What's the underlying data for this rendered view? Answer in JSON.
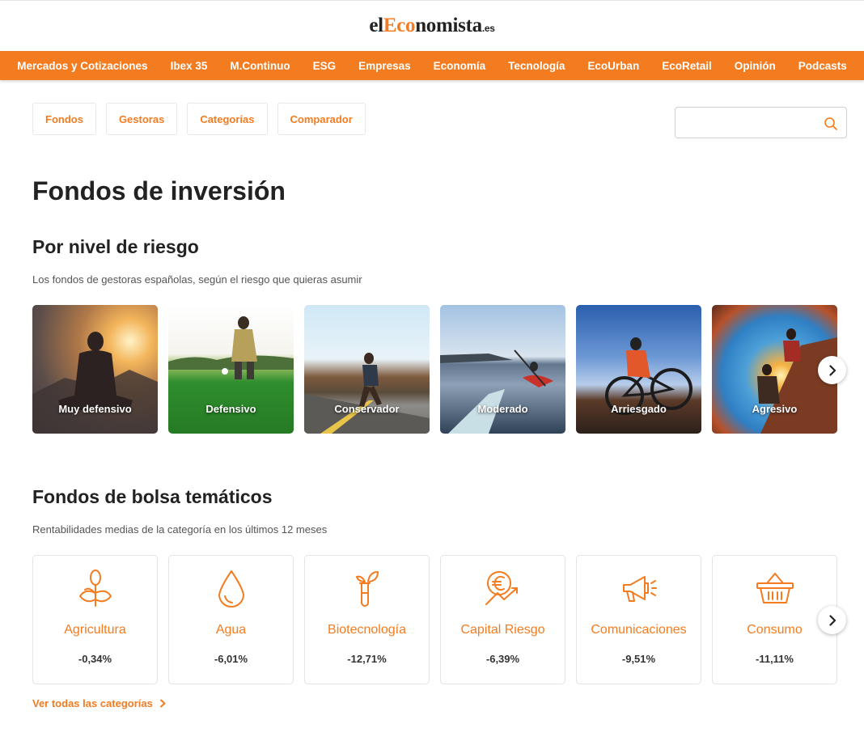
{
  "logo": {
    "part1": "el",
    "part2": "Eco",
    "part3": "nomista",
    "tld": ".es"
  },
  "nav": [
    "Mercados y Cotizaciones",
    "Ibex 35",
    "M.Continuo",
    "ESG",
    "Empresas",
    "Economía",
    "Tecnología",
    "EcoUrban",
    "EcoRetail",
    "Opinión",
    "Podcasts"
  ],
  "subnav": [
    "Fondos",
    "Gestoras",
    "Categorías",
    "Comparador"
  ],
  "search": {
    "placeholder": "",
    "icon": "search-icon"
  },
  "page_title": "Fondos de inversión",
  "risk": {
    "title": "Por nivel de riesgo",
    "subtitle": "Los fondos de gestoras españolas, según el riesgo que quieras asumir",
    "items": [
      "Muy defensivo",
      "Defensivo",
      "Conservador",
      "Moderado",
      "Arriesgado",
      "Agresivo"
    ]
  },
  "thematic": {
    "title": "Fondos de bolsa temáticos",
    "subtitle": "Rentabilidades medias de la categoría en los últimos 12 meses",
    "items": [
      {
        "name": "Agricultura",
        "value": "-0,34%",
        "icon": "plant-icon"
      },
      {
        "name": "Agua",
        "value": "-6,01%",
        "icon": "water-drop-icon"
      },
      {
        "name": "Biotecnología",
        "value": "-12,71%",
        "icon": "test-tube-icon"
      },
      {
        "name": "Capital Riesgo",
        "value": "-6,39%",
        "icon": "euro-growth-icon"
      },
      {
        "name": "Comunicaciones",
        "value": "-9,51%",
        "icon": "megaphone-icon"
      },
      {
        "name": "Consumo",
        "value": "-11,11%",
        "icon": "basket-icon"
      }
    ],
    "see_all": "Ver todas las categorías"
  },
  "colors": {
    "accent": "#f47c20",
    "text": "#222222"
  }
}
